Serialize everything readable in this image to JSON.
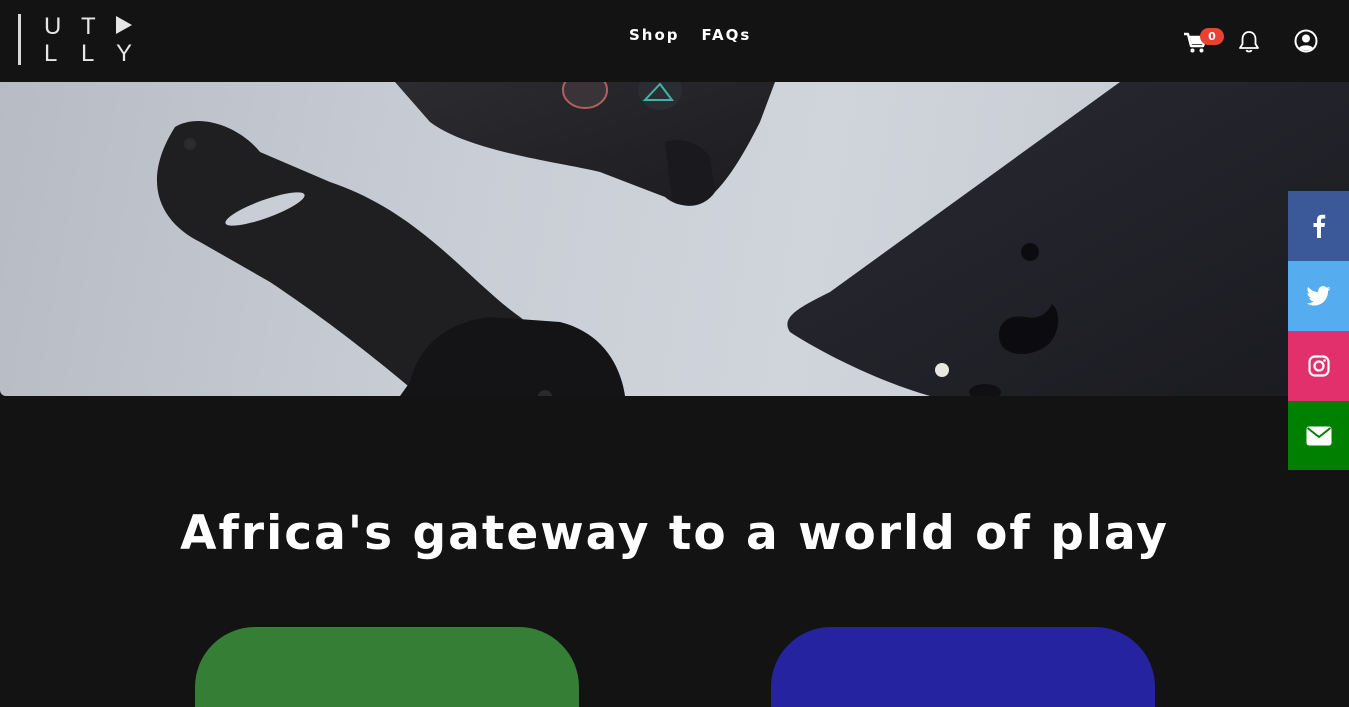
{
  "header": {
    "logo": {
      "letters_top": [
        "U",
        "T"
      ],
      "letters_bottom": [
        "L",
        "L",
        "Y"
      ]
    },
    "nav": [
      {
        "label": "Shop"
      },
      {
        "label": "FAQs"
      }
    ],
    "cart": {
      "icon": "cart-icon",
      "count": "0",
      "badge_color": "#e94234"
    },
    "notifications": {
      "icon": "bell-icon"
    },
    "account": {
      "icon": "user-circle-icon"
    }
  },
  "hero": {
    "description_icon": "hero-image"
  },
  "social": [
    {
      "name": "facebook",
      "icon": "facebook-icon",
      "color": "#3b5998"
    },
    {
      "name": "twitter",
      "icon": "twitter-icon",
      "color": "#55acee"
    },
    {
      "name": "instagram",
      "icon": "instagram-icon",
      "color": "#e1306c"
    },
    {
      "name": "email",
      "icon": "envelope-icon",
      "color": "#008000"
    }
  ],
  "main": {
    "tagline": "Africa's gateway to a world of play"
  },
  "cards": [
    {
      "color": "#347e35"
    },
    {
      "color": "#2523a0"
    }
  ],
  "colors": {
    "background": "#131313",
    "text": "#ffffff"
  }
}
